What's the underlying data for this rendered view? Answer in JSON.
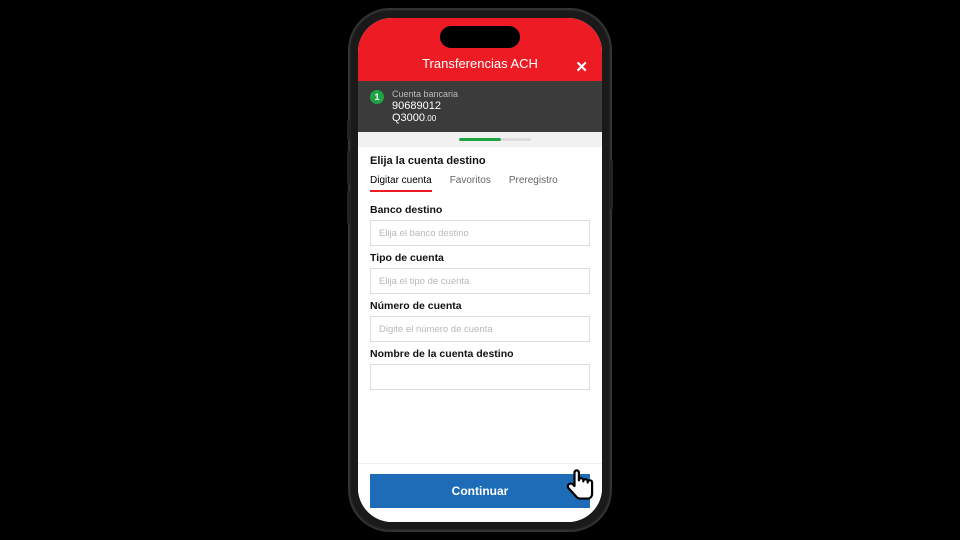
{
  "header": {
    "title": "Transferencias ACH"
  },
  "account": {
    "step": "1",
    "label": "Cuenta bancaria",
    "number": "90689012",
    "amount_int": "Q3000",
    "amount_cents": ".00"
  },
  "section": {
    "title": "Elija la cuenta destino"
  },
  "tabs": [
    {
      "label": "Digitar cuenta"
    },
    {
      "label": "Favoritos"
    },
    {
      "label": "Preregistro"
    }
  ],
  "fields": {
    "bank": {
      "label": "Banco destino",
      "placeholder": "Elija el banco destino"
    },
    "type": {
      "label": "Tipo de cuenta",
      "placeholder": "Elija el tipo de cuenta"
    },
    "number": {
      "label": "Número de cuenta",
      "placeholder": "Digite el número de cuenta"
    },
    "name": {
      "label": "Nombre de la cuenta destino",
      "placeholder": ""
    }
  },
  "footer": {
    "continue": "Continuar"
  }
}
